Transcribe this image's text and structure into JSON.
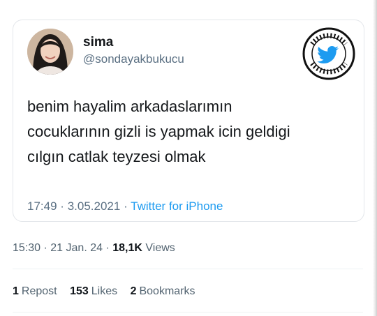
{
  "tweet": {
    "display_name": "sima",
    "handle": "@sondayakbukucu",
    "lines": [
      "benim hayalim arkadaslarımın",
      "cocuklarının gizli is yapmak icin geldigi",
      "cılgın catlak teyzesi olmak"
    ],
    "time": "17:49",
    "date": "3.05.2021",
    "source": "Twitter for iPhone",
    "badge": {
      "text": "10/10 TWEETLER @ONONTWEETLER",
      "icon": "twitter-bird-icon",
      "color": "#1d9bf0"
    },
    "avatar_icon": "avatar"
  },
  "post": {
    "time": "15:30",
    "date": "21 Jan. 24",
    "views_count": "18,1K",
    "views_label": "Views"
  },
  "stats": [
    {
      "count": "1",
      "label": "Repost"
    },
    {
      "count": "153",
      "label": "Likes"
    },
    {
      "count": "2",
      "label": "Bookmarks"
    }
  ],
  "sep": "·"
}
